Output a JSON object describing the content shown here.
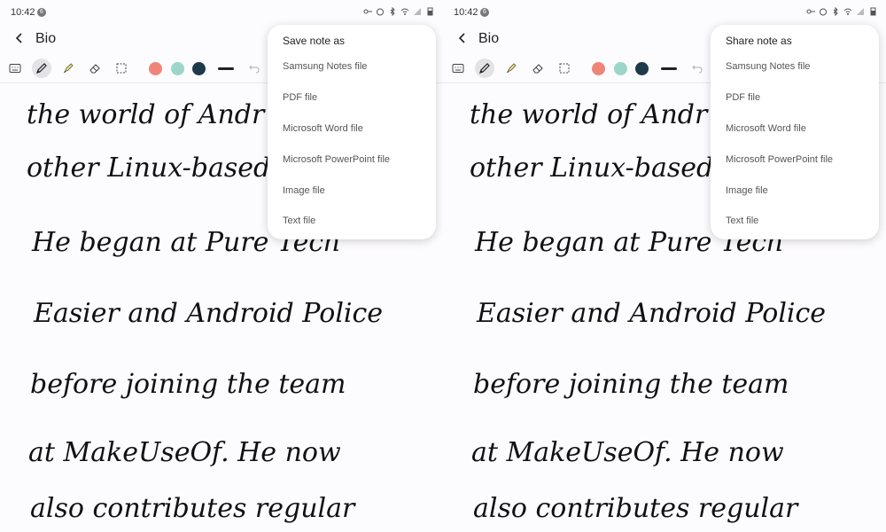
{
  "status": {
    "time": "10:42",
    "badge": "6"
  },
  "note": {
    "title": "Bio"
  },
  "palette": {
    "coral": "#ee8577",
    "mint": "#9bd6c9",
    "navy": "#1c3a4a",
    "stroke": "#222222"
  },
  "icons": [
    "back-arrow-icon",
    "keyboard-icon",
    "pen-icon",
    "highlighter-icon",
    "eraser-icon",
    "lasso-select-icon",
    "undo-icon"
  ],
  "handwriting": {
    "lines": [
      "the world of Andr",
      "other Linux-based",
      "He began at Pure Tech",
      "Easier and Android Police",
      "before joining the team",
      "at MakeUseOf. He now",
      "also contributes regular"
    ]
  },
  "left_menu": {
    "title": "Save note as",
    "items": [
      "Samsung Notes file",
      "PDF file",
      "Microsoft Word file",
      "Microsoft PowerPoint file",
      "Image file",
      "Text file"
    ]
  },
  "right_menu": {
    "title": "Share note as",
    "items": [
      "Samsung Notes file",
      "PDF file",
      "Microsoft Word file",
      "Microsoft PowerPoint file",
      "Image file",
      "Text file"
    ]
  }
}
